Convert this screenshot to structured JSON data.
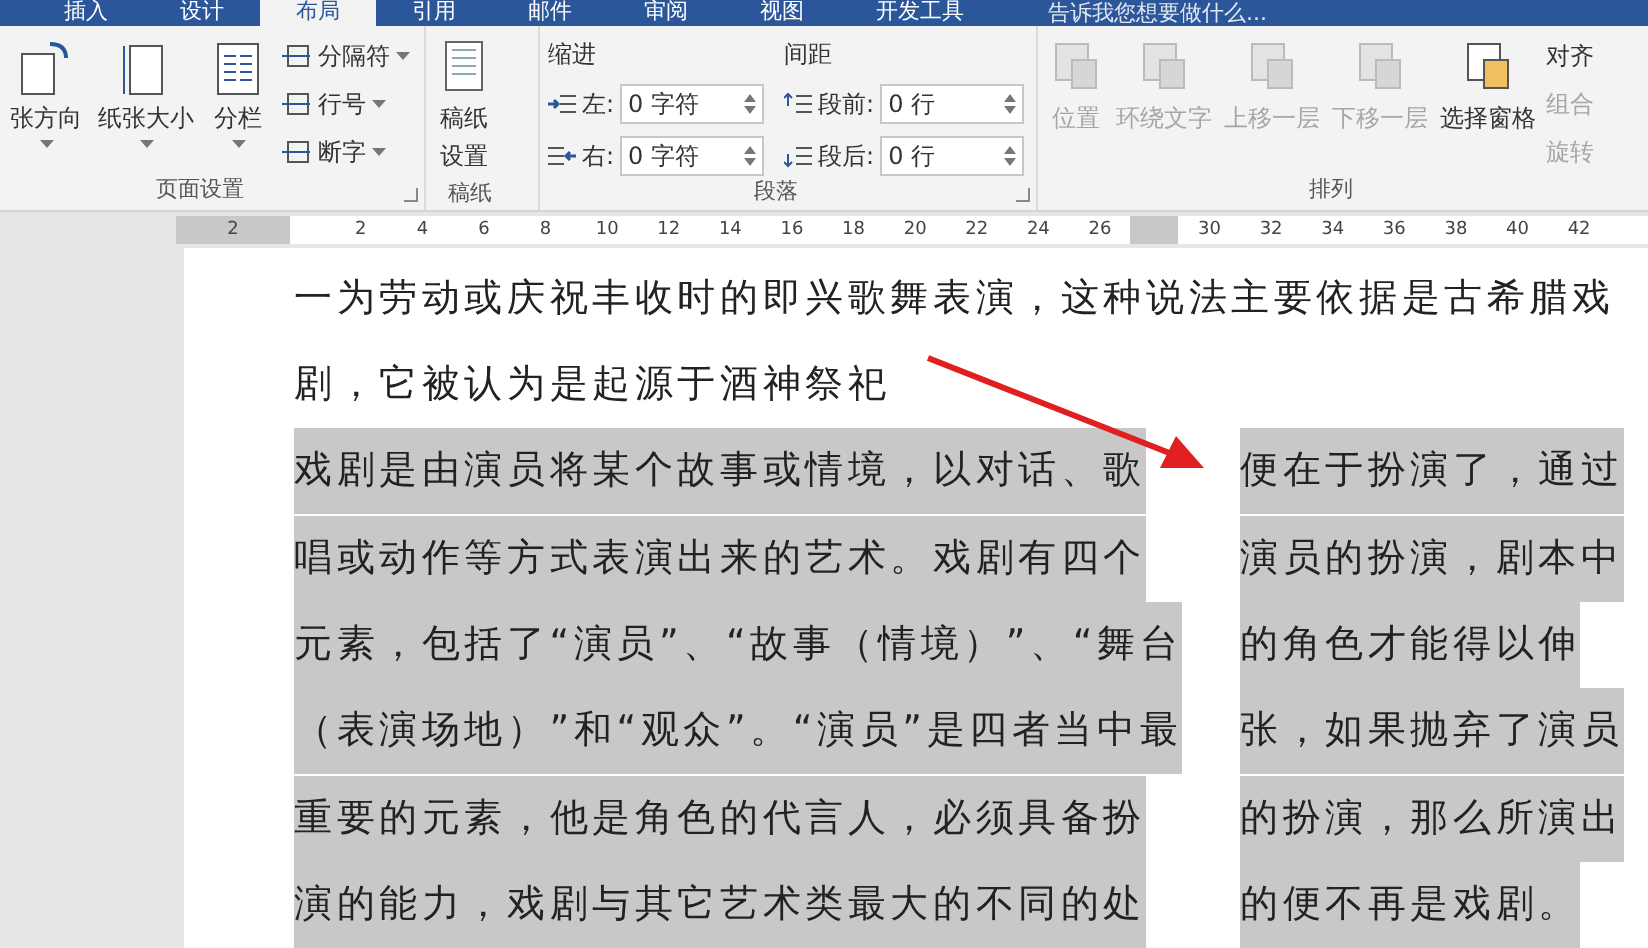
{
  "tabs": [
    {
      "label": "插入",
      "selected": false
    },
    {
      "label": "设计",
      "selected": false
    },
    {
      "label": "布局",
      "selected": true
    },
    {
      "label": "引用",
      "selected": false
    },
    {
      "label": "邮件",
      "selected": false
    },
    {
      "label": "审阅",
      "selected": false
    },
    {
      "label": "视图",
      "selected": false
    },
    {
      "label": "开发工具",
      "selected": false
    }
  ],
  "tell_me": "告诉我您想要做什么...",
  "ribbon": {
    "page_setup": {
      "label": "页面设置",
      "big_buttons": [
        "张方向",
        "纸张大小",
        "分栏"
      ],
      "small_buttons": [
        "分隔符",
        "行号",
        "断字"
      ]
    },
    "manuscript": {
      "label": "稿纸",
      "button": [
        "稿纸",
        "设置"
      ]
    },
    "paragraph": {
      "label": "段落",
      "indent_title": "缩进",
      "spacing_title": "间距",
      "indent": [
        {
          "kind": "left",
          "label": "左:",
          "value": "0 字符"
        },
        {
          "kind": "right",
          "label": "右:",
          "value": "0 字符"
        }
      ],
      "spacing": [
        {
          "kind": "before",
          "label": "段前:",
          "value": "0 行"
        },
        {
          "kind": "after",
          "label": "段后:",
          "value": "0 行"
        }
      ]
    },
    "arrange": {
      "label": "排列",
      "big_buttons": [
        {
          "label": "位置",
          "disabled": true
        },
        {
          "label": "环绕文字",
          "disabled": true
        },
        {
          "label": "上移一层",
          "disabled": true
        },
        {
          "label": "下移一层",
          "disabled": true
        },
        {
          "label": "选择窗格",
          "disabled": false
        }
      ],
      "small_buttons": [
        {
          "label": "对齐",
          "disabled": false
        },
        {
          "label": "组合",
          "disabled": true
        },
        {
          "label": "旋转",
          "disabled": true
        }
      ]
    }
  },
  "ruler": {
    "left_labels": [
      "2"
    ],
    "labels": [
      "2",
      "4",
      "6",
      "8",
      "10",
      "12",
      "14",
      "16",
      "18",
      "20",
      "22",
      "24",
      "26"
    ],
    "right_labels": [
      "30",
      "32",
      "34",
      "36",
      "38",
      "40",
      "42"
    ]
  },
  "document": {
    "intro_lines": [
      {
        "text": "一为劳动或庆祝丰收时的即兴歌舞表演，这种说法主要依据是古希腊戏",
        "selected": false
      },
      {
        "text": "剧，它被认为是起源于酒神祭祀",
        "selected": false
      }
    ],
    "left_column": [
      {
        "text": "戏剧是由演员将某个故事或情境，以对话、歌",
        "selected": true
      },
      {
        "text": "唱或动作等方式表演出来的艺术。戏剧有四个",
        "selected": true
      },
      {
        "text": "元素，包括了“演员”、“故事（情境）”、“舞台",
        "selected": true
      },
      {
        "text": "（表演场地）”和“观众”。“演员”是四者当中最",
        "selected": true
      },
      {
        "text": "重要的元素，他是角色的代言人，必须具备扮",
        "selected": true
      },
      {
        "text": "演的能力，戏剧与其它艺术类最大的不同的处",
        "selected": true
      }
    ],
    "right_column": [
      {
        "text": "便在于扮演了，通过",
        "selected": true
      },
      {
        "text": "演员的扮演，剧本中",
        "selected": true
      },
      {
        "text": "的角色才能得以伸",
        "selected": true
      },
      {
        "text": "张，如果抛弃了演员",
        "selected": true
      },
      {
        "text": "的扮演，那么所演出",
        "selected": true
      },
      {
        "text": "的便不再是戏剧。",
        "selected": true
      }
    ]
  }
}
